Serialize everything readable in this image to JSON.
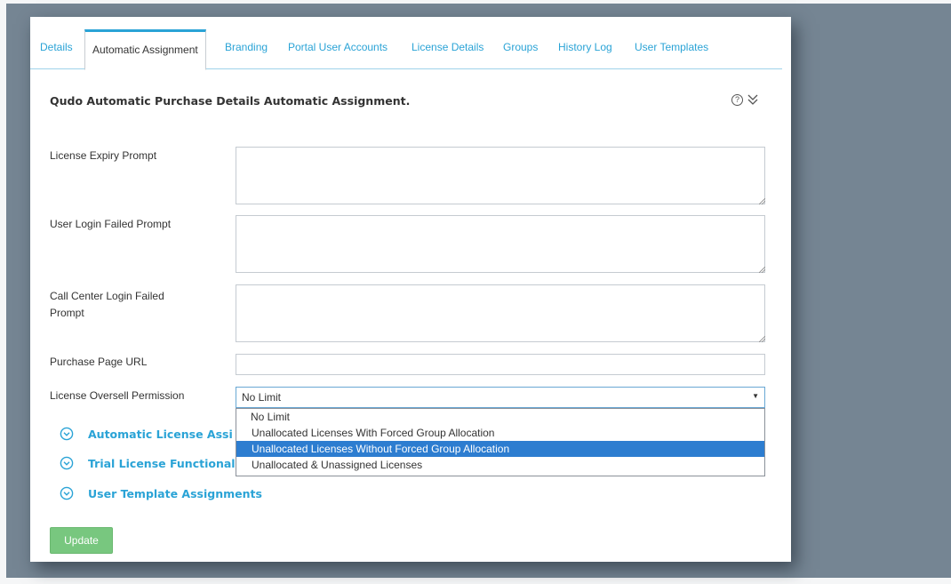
{
  "tabs": [
    {
      "label": "Details"
    },
    {
      "label": "Automatic Assignment",
      "active": true
    },
    {
      "label": "Branding"
    },
    {
      "label": "Portal User Accounts"
    },
    {
      "label": "License Details"
    },
    {
      "label": "Groups"
    },
    {
      "label": "History Log"
    },
    {
      "label": "User Templates"
    }
  ],
  "header": {
    "title": "Qudo Automatic Purchase Details Automatic Assignment.",
    "help_glyph": "?"
  },
  "form": {
    "license_expiry_prompt": {
      "label": "License Expiry Prompt",
      "value": ""
    },
    "user_login_failed_prompt": {
      "label": "User Login Failed Prompt",
      "value": ""
    },
    "call_center_login_failed_prompt": {
      "label_line1": "Call Center Login Failed",
      "label_line2": "Prompt",
      "value": ""
    },
    "purchase_page_url": {
      "label": "Purchase Page URL",
      "value": ""
    },
    "license_oversell_permission": {
      "label": "License Oversell Permission",
      "selected_value": "No Limit",
      "arrow_glyph": "▼",
      "options": [
        {
          "label": "No Limit"
        },
        {
          "label": "Unallocated Licenses With Forced Group Allocation"
        },
        {
          "label": "Unallocated Licenses Without Forced Group Allocation",
          "highlighted": true
        },
        {
          "label": "Unallocated & Unassigned Licenses"
        }
      ]
    }
  },
  "sections": [
    {
      "label": "Automatic License Assi"
    },
    {
      "label": "Trial License Functional"
    },
    {
      "label": "User Template Assignments"
    }
  ],
  "actions": {
    "update_label": "Update"
  },
  "colors": {
    "accent": "#2aa3d6",
    "background": "#758593",
    "selected_option": "#2d7dd0",
    "update_button": "#78c77f"
  }
}
